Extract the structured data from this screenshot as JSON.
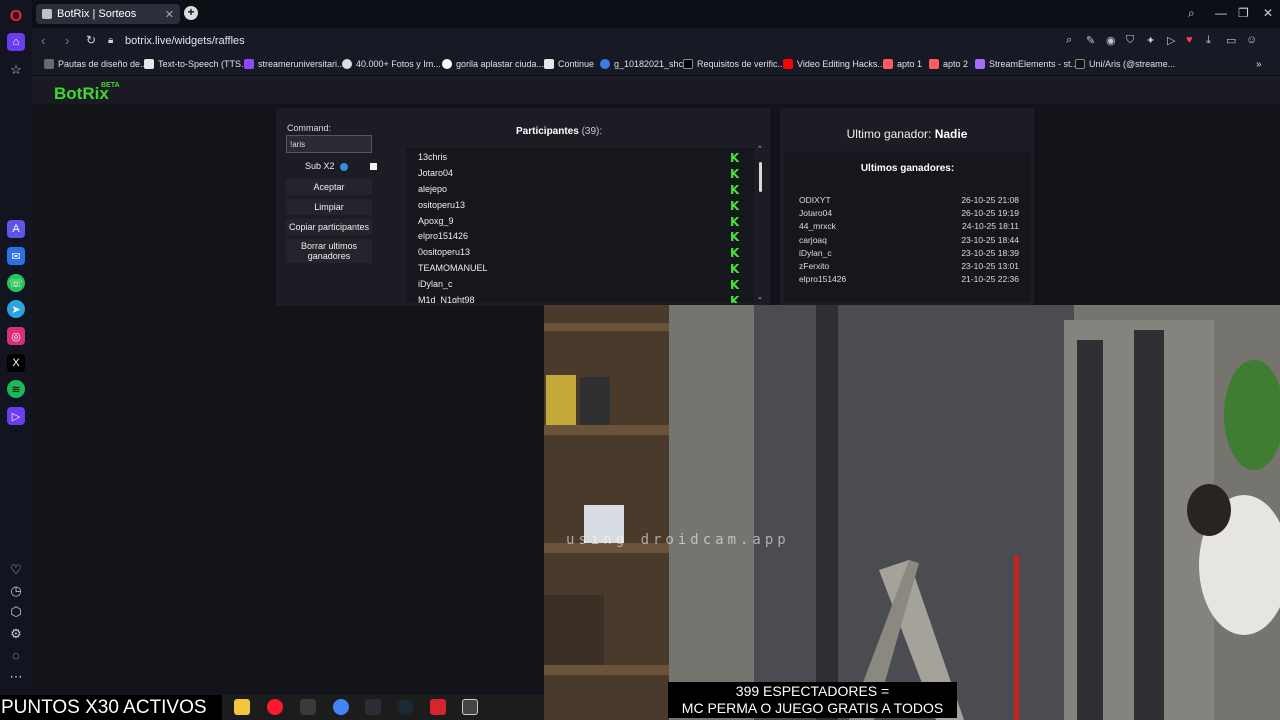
{
  "browser": {
    "tab_title": "BotRix | Sorteos",
    "tab_close": "✕",
    "new_tab": "+",
    "url": "botrix.live/widgets/raffles",
    "bookmarks": [
      "Pautas de diseño de...",
      "Text-to-Speech (TTS...",
      "streameruniversitari...",
      "40.000+ Fotos y Im...",
      "gorila aplastar ciuda...",
      "Continue",
      "g_10182021_shcc",
      "Requisitos de verific...",
      "Video Editing Hacks...",
      "apto 1",
      "apto 2",
      "StreamElements - st...",
      "Uni/Aris (@streame..."
    ],
    "colors": {
      "accent": "#ff1b2d",
      "background": "#0d0f17"
    }
  },
  "botrix": {
    "logo": "BotRix",
    "logo_beta": "BETA",
    "brand_color": "#40d832",
    "command_label": "Command:",
    "command_value": "!aris",
    "sub_label": "Sub X2",
    "buttons": {
      "accept": "Aceptar",
      "clear": "Limpiar",
      "copy": "Copiar participantes",
      "delete_line1": "Borrar ultimos",
      "delete_line2": "ganadores"
    },
    "participants_label": "Participantes",
    "participants_count": "(39):",
    "participants": [
      "13chris",
      "Jotaro04",
      "alejepo",
      "ositoperu13",
      "Apoxg_9",
      "elpro151426",
      "0ositoperu13",
      "TEAMOMANUEL",
      "iDylan_c",
      "M1d_N1ght98"
    ],
    "platform_icon": "kick-icon",
    "last_winner_label": "Ultimo ganador:",
    "last_winner_name": "Nadie",
    "winners_title": "Ultimos ganadores:",
    "winners": [
      {
        "name": "ODIXYT",
        "date": "26-10-25 21:08"
      },
      {
        "name": "Jotaro04",
        "date": "26-10-25 19:19"
      },
      {
        "name": "44_mrxck",
        "date": "24-10-25 18:11"
      },
      {
        "name": "carjoaq",
        "date": "23-10-25 18:44"
      },
      {
        "name": "iDylan_c",
        "date": "23-10-25 18:39"
      },
      {
        "name": "zFerxito",
        "date": "23-10-25 13:01"
      },
      {
        "name": "elpro151426",
        "date": "21-10-25 22:36"
      }
    ]
  },
  "stream_overlay": {
    "points_banner": "PUNTOS X30 ACTIVOS",
    "spectators_line1": "399 ESPECTADORES =",
    "spectators_line2": "MC PERMA O JUEGO GRATIS A TODOS",
    "watermark": "using droidcam.app"
  }
}
